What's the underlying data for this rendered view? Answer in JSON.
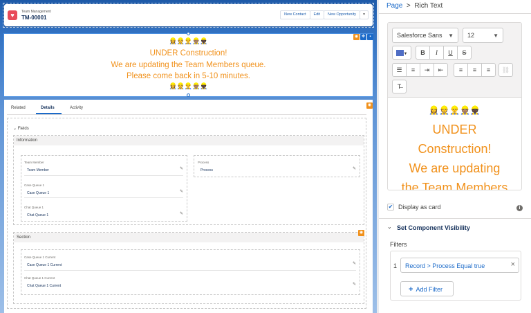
{
  "record": {
    "object_label": "Team Management",
    "name": "TM-00001",
    "actions": [
      "New Contact",
      "Edit",
      "New Opportunity"
    ]
  },
  "rich_text": {
    "emoji": "👷‍♀️👷👷‍♂️👷🏽👷🏿",
    "lines": [
      "UNDER Construction!",
      "We are updating the Team Members queue.",
      "Please come back in 5-10 minutes."
    ]
  },
  "tabs": [
    "Related",
    "Details",
    "Activity"
  ],
  "fields": {
    "header": "Fields",
    "info_section": "Information",
    "left_fields": [
      {
        "label": "Team Member",
        "value": "Team Member"
      },
      {
        "label": "Case Queue 1",
        "value": "Case Queue 1"
      },
      {
        "label": "Chat Queue 1",
        "value": "Chat Queue 1"
      }
    ],
    "right_fields": [
      {
        "label": "Process",
        "value": "Process"
      }
    ],
    "section2": "Section",
    "section2_fields": [
      {
        "label": "Case Queue 1 Current",
        "value": "Case Queue 1 Current"
      },
      {
        "label": "Chat Queue 1 Current",
        "value": "Chat Queue 1 Current"
      }
    ]
  },
  "panel": {
    "breadcrumb_page": "Page",
    "breadcrumb_sep": ">",
    "breadcrumb_current": "Rich Text",
    "font_family": "Salesforce Sans",
    "font_size": "12",
    "text_color": "#4f6dc4",
    "accent_color": "#f1911b",
    "editor_lines": [
      "UNDER",
      "Construction!",
      "We are updating",
      "the Team Members"
    ],
    "display_as_card_label": "Display as card",
    "display_as_card_checked": true,
    "visibility_header": "Set Component Visibility",
    "filters_label": "Filters",
    "filter_index": "1",
    "filter_text": "Record > Process Equal true",
    "add_filter_label": "Add Filter"
  }
}
